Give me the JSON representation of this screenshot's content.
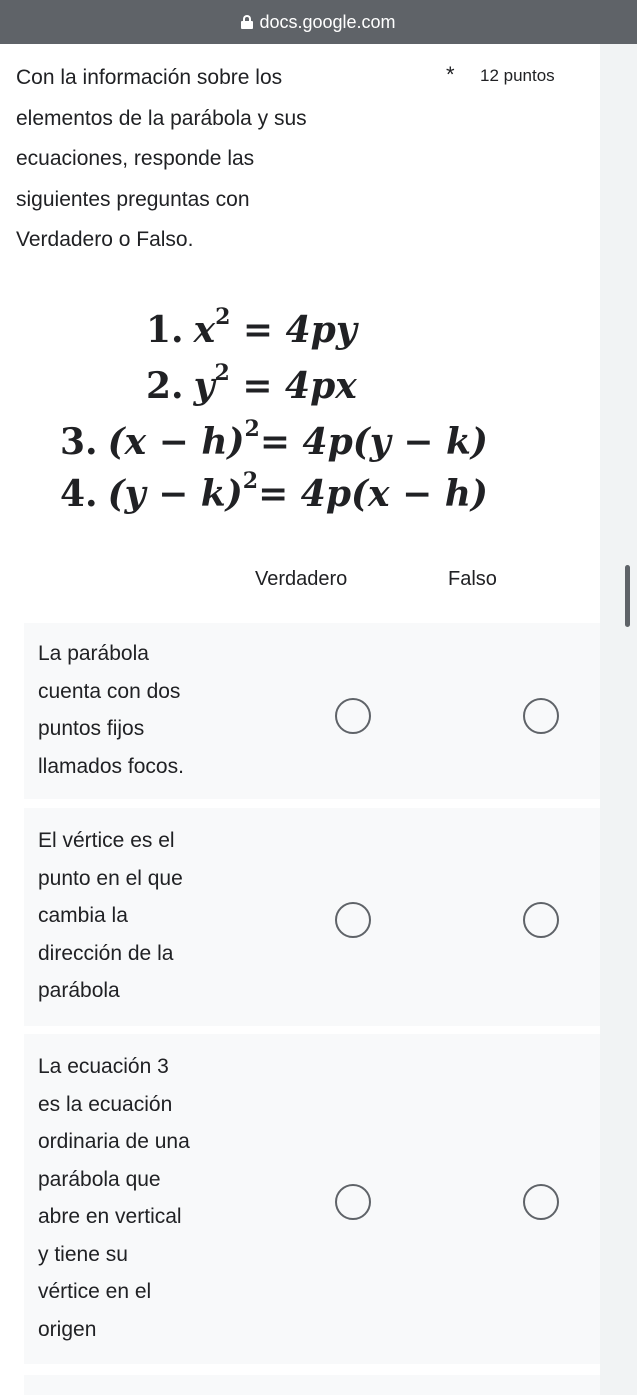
{
  "browser": {
    "url": "docs.google.com"
  },
  "question": {
    "lines": [
      "Con la información sobre los",
      "elementos de la parábola y sus",
      "ecuaciones, responde las",
      "siguientes preguntas con",
      "Verdadero o Falso."
    ],
    "required_marker": "*",
    "points": "12 puntos"
  },
  "equations": [
    {
      "number": "1.",
      "parts": [
        "x",
        "2",
        " = 4py"
      ]
    },
    {
      "number": "2.",
      "parts": [
        "y",
        "2",
        " = 4px"
      ]
    },
    {
      "number": "3.",
      "parts": [
        "(x − h)",
        "2",
        "= 4p(y − k)"
      ]
    },
    {
      "number": "4.",
      "parts": [
        "(y − k)",
        "2",
        "= 4p(x − h)"
      ]
    }
  ],
  "grid": {
    "columns": [
      "Verdadero",
      "Falso"
    ],
    "rows": [
      {
        "lines": [
          "La parábola",
          "cuenta con dos",
          "puntos fijos",
          "llamados focos."
        ]
      },
      {
        "lines": [
          "El vértice es el",
          "punto en el que",
          "cambia la",
          "dirección de la",
          "parábola"
        ]
      },
      {
        "lines": [
          "La ecuación 3",
          "es la ecuación",
          "ordinaria de una",
          "parábola  que",
          "abre en vertical",
          "y tiene su",
          "vértice en el",
          "origen"
        ]
      }
    ]
  }
}
